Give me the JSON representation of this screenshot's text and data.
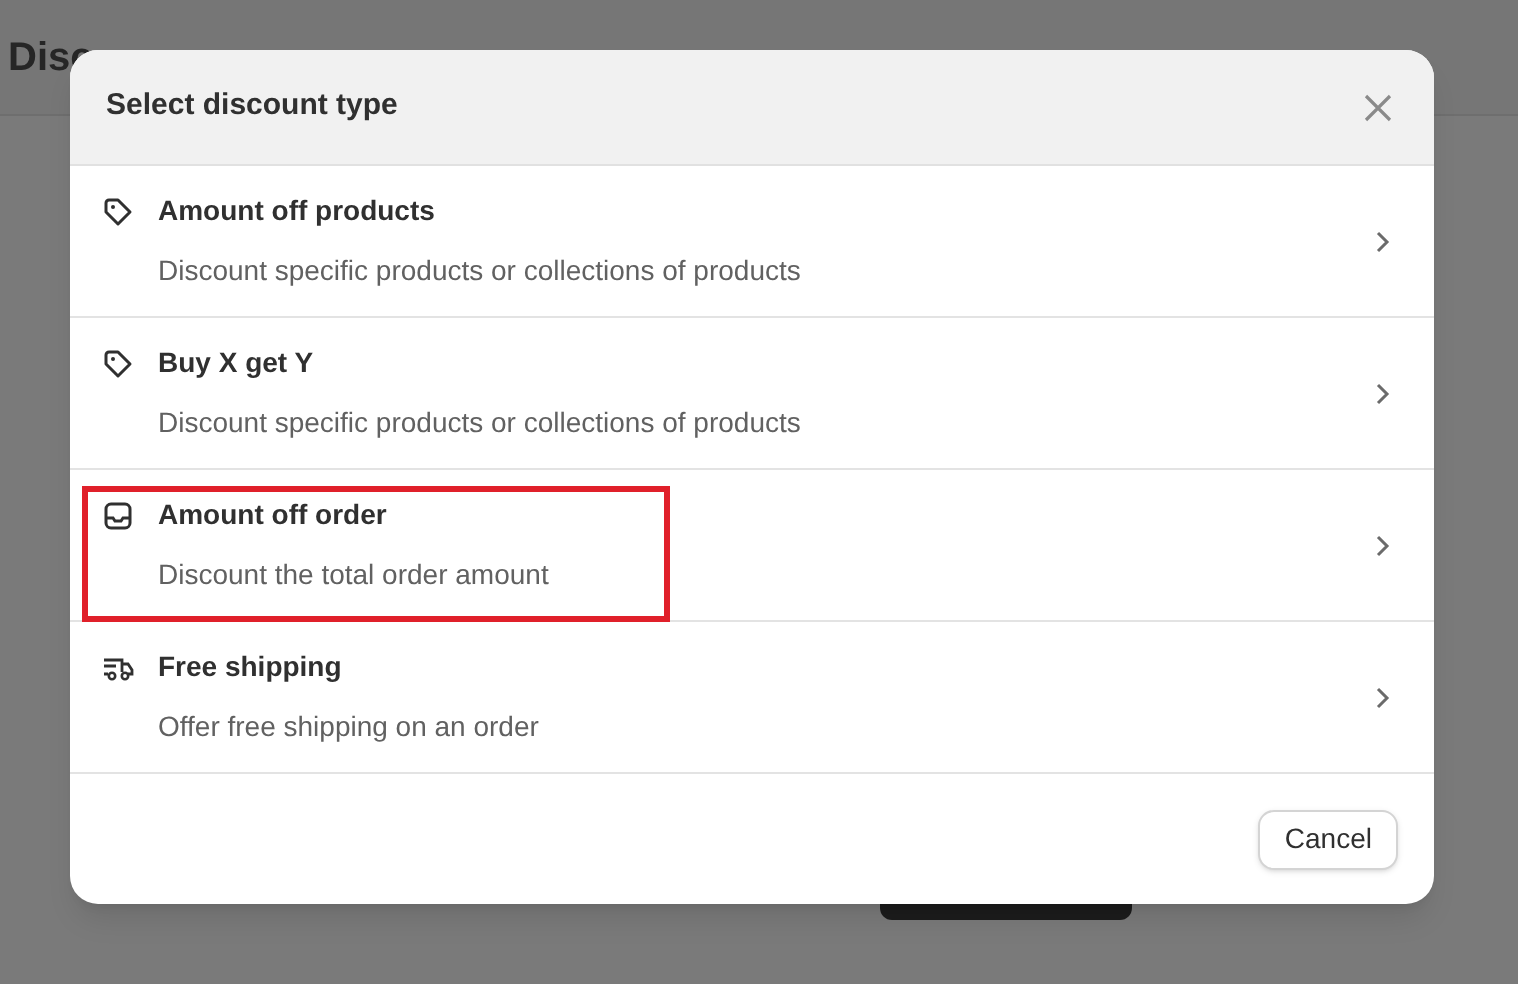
{
  "page": {
    "title": "Disc"
  },
  "dialog": {
    "title": "Select discount type",
    "options": [
      {
        "kind": "tag",
        "title": "Amount off products",
        "description": "Discount specific products or collections of products",
        "highlighted": false
      },
      {
        "kind": "tag",
        "title": "Buy X get Y",
        "description": "Discount specific products or collections of products",
        "highlighted": false
      },
      {
        "kind": "tray",
        "title": "Amount off order",
        "description": "Discount the total order amount",
        "highlighted": true
      },
      {
        "kind": "truck",
        "title": "Free shipping",
        "description": "Offer free shipping on an order",
        "highlighted": false
      }
    ],
    "buttons": [
      "Cancel"
    ]
  }
}
